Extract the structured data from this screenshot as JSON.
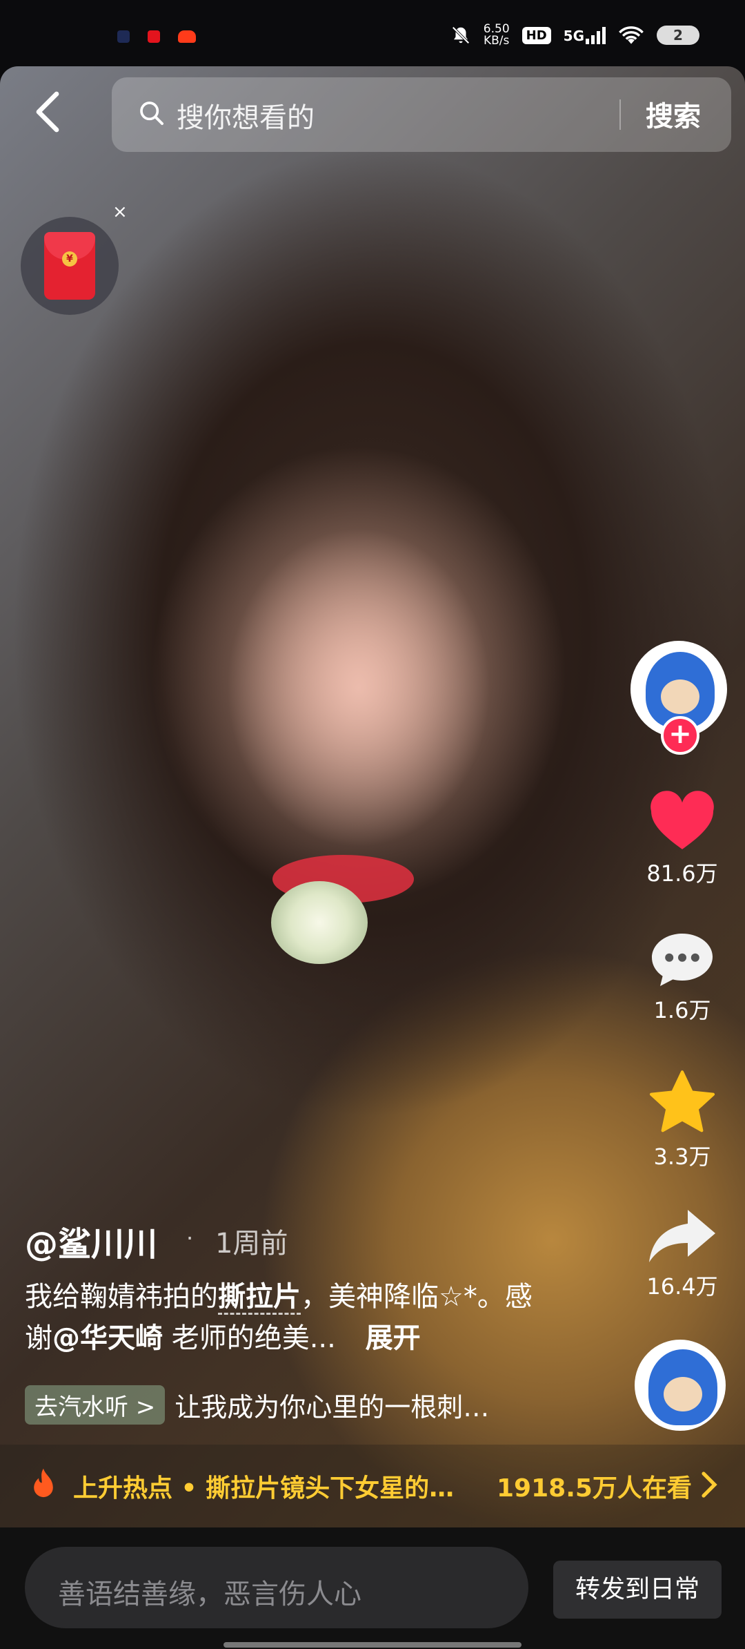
{
  "status": {
    "netspeed_value": "6.50",
    "netspeed_unit": "KB/s",
    "hd": "HD",
    "network": "5G",
    "battery": "2"
  },
  "search": {
    "placeholder": "搜你想看的",
    "button": "搜索"
  },
  "red_packet": {
    "close": "×"
  },
  "rail": {
    "likes": "81.6万",
    "comments": "1.6万",
    "favorites": "3.3万",
    "shares": "16.4万",
    "follow": "+"
  },
  "post": {
    "author": "@鲨川川",
    "separator": "·",
    "time": "1周前",
    "caption_part1": "我给鞠婧祎拍的",
    "caption_highlight": "撕拉片",
    "caption_part2": "，美神降临☆*。感谢",
    "mention": "@华天崎",
    "caption_part3": " 老师的绝美...",
    "expand": "展开",
    "music_tag": "去汽水听 >",
    "music_text": "让我成为你心里的一根刺…"
  },
  "hot": {
    "label": "上升热点 • 撕拉片镜头下女星的…",
    "viewers": "1918.5万人在看"
  },
  "bottom": {
    "comment_placeholder": "善语结善缘，恶言伤人心",
    "forward_button": "转发到日常"
  },
  "colors": {
    "accent": "#fe2c55",
    "hot": "#ffcc33",
    "favorite": "#ffc21a"
  }
}
